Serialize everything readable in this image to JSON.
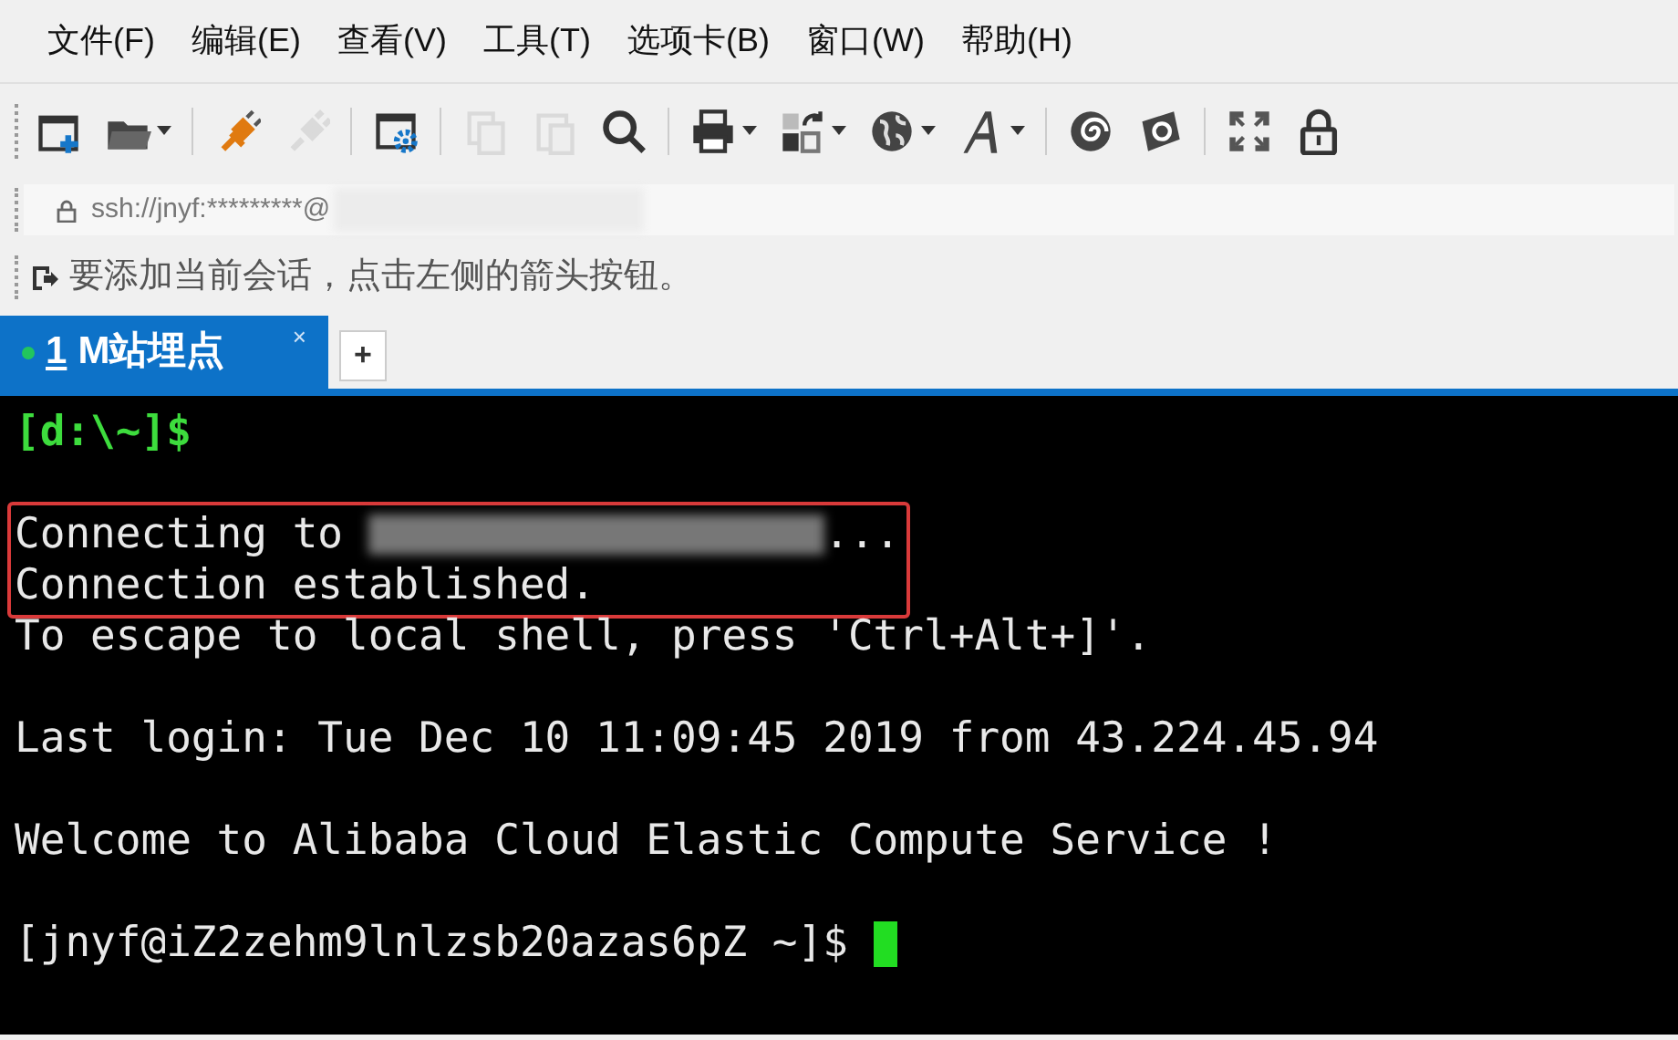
{
  "menu_bar": [
    "文件(F)",
    "编辑(E)",
    "查看(V)",
    "工具(T)",
    "选项卡(B)",
    "窗口(W)",
    "帮助(H)"
  ],
  "toolbar": [
    {
      "kind": "new-session",
      "dropdown": false,
      "disabled": false
    },
    {
      "kind": "open",
      "dropdown": true,
      "disabled": false
    },
    {
      "kind": "separator"
    },
    {
      "kind": "connect",
      "dropdown": false,
      "disabled": false
    },
    {
      "kind": "disconnect",
      "dropdown": false,
      "disabled": true
    },
    {
      "kind": "separator"
    },
    {
      "kind": "properties",
      "dropdown": false,
      "disabled": false
    },
    {
      "kind": "separator"
    },
    {
      "kind": "copy",
      "dropdown": false,
      "disabled": true
    },
    {
      "kind": "paste",
      "dropdown": false,
      "disabled": true
    },
    {
      "kind": "find",
      "dropdown": false,
      "disabled": false
    },
    {
      "kind": "separator"
    },
    {
      "kind": "print",
      "dropdown": true,
      "disabled": false
    },
    {
      "kind": "transfer",
      "dropdown": true,
      "disabled": false
    },
    {
      "kind": "globe",
      "dropdown": true,
      "disabled": false
    },
    {
      "kind": "font",
      "dropdown": true,
      "disabled": false
    },
    {
      "kind": "separator"
    },
    {
      "kind": "spiral",
      "dropdown": false,
      "disabled": false
    },
    {
      "kind": "shield",
      "dropdown": false,
      "disabled": false
    },
    {
      "kind": "separator"
    },
    {
      "kind": "fullscreen",
      "dropdown": false,
      "disabled": false
    },
    {
      "kind": "lock",
      "dropdown": false,
      "disabled": false
    }
  ],
  "address_bar": {
    "value": "ssh://jnyf:*********@",
    "redacted": true
  },
  "session_hint": "要添加当前会话，点击左侧的箭头按钮。",
  "tabs": [
    {
      "number": "1",
      "label": "M站埋点",
      "selected": true,
      "connected": true,
      "close": "×"
    }
  ],
  "new_tab": "+",
  "terminal": {
    "lines": [
      {
        "kind": "prompt",
        "text": "[d:\\~]$",
        "highlighted": false
      },
      {
        "kind": "blank"
      },
      {
        "kind": "redacted",
        "text": "Connecting to ",
        "after": "...",
        "highlighted": true
      },
      {
        "kind": "output",
        "text": "Connection established.",
        "highlighted": true
      },
      {
        "kind": "output",
        "text": "To escape to local shell, press 'Ctrl+Alt+]'.",
        "highlighted": false
      },
      {
        "kind": "blank"
      },
      {
        "kind": "output",
        "text": "Last login: Tue Dec 10 11:09:45 2019 from 43.224.45.94",
        "highlighted": false
      },
      {
        "kind": "blank"
      },
      {
        "kind": "output",
        "text": "Welcome to Alibaba Cloud Elastic Compute Service !",
        "highlighted": false
      },
      {
        "kind": "blank"
      },
      {
        "kind": "cursor",
        "text": "[jnyf@iZ2zehm9lnlzsb20azas6pZ ~]$ ",
        "highlighted": false
      }
    ]
  }
}
